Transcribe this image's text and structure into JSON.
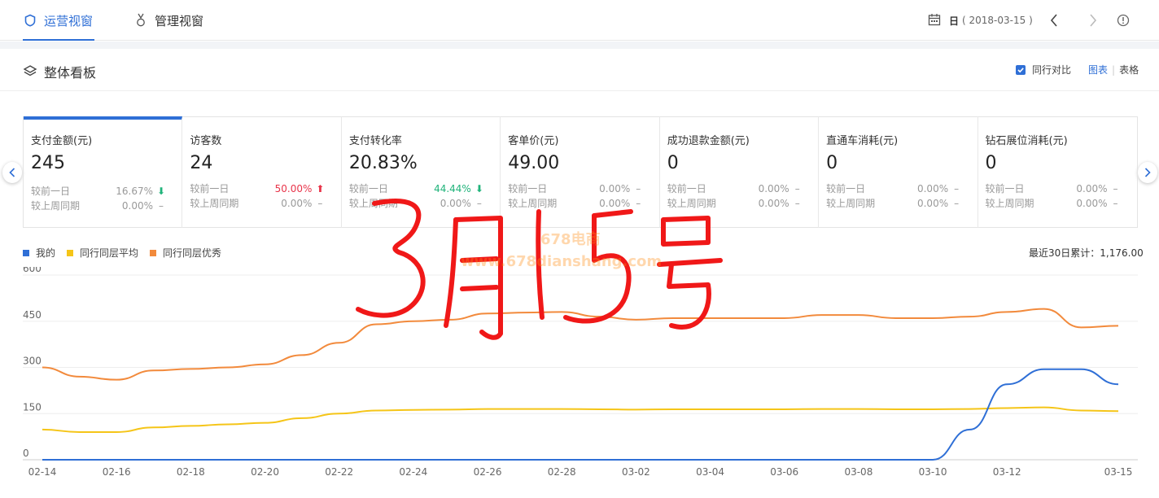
{
  "nav": {
    "tabs": [
      {
        "label": "运营视窗",
        "active": true,
        "icon": "shield-icon"
      },
      {
        "label": "管理视窗",
        "active": false,
        "icon": "medal-icon"
      }
    ],
    "date_mode": "日",
    "date_value": "( 2018-03-15 )"
  },
  "section": {
    "title": "整体看板",
    "compare_label": "同行对比",
    "compare_checked": true,
    "view_chart": "图表",
    "view_table": "表格"
  },
  "kpis": [
    {
      "name": "支付金额(元)",
      "value": "245",
      "day_label": "较前一日",
      "day_change": "16.67%",
      "day_dir": "down",
      "week_label": "较上周同期",
      "week_change": "0.00%",
      "week_dir": "flat"
    },
    {
      "name": "访客数",
      "value": "24",
      "day_label": "较前一日",
      "day_change": "50.00%",
      "day_dir": "up",
      "week_label": "较上周同期",
      "week_change": "0.00%",
      "week_dir": "flat"
    },
    {
      "name": "支付转化率",
      "value": "20.83%",
      "day_label": "较前一日",
      "day_change": "44.44%",
      "day_dir": "down",
      "week_label": "较上周同期",
      "week_change": "0.00%",
      "week_dir": "flat"
    },
    {
      "name": "客单价(元)",
      "value": "49.00",
      "day_label": "较前一日",
      "day_change": "0.00%",
      "day_dir": "flat",
      "week_label": "较上周同期",
      "week_change": "0.00%",
      "week_dir": "flat"
    },
    {
      "name": "成功退款金额(元)",
      "value": "0",
      "day_label": "较前一日",
      "day_change": "0.00%",
      "day_dir": "flat",
      "week_label": "较上周同期",
      "week_change": "0.00%",
      "week_dir": "flat"
    },
    {
      "name": "直通车消耗(元)",
      "value": "0",
      "day_label": "较前一日",
      "day_change": "0.00%",
      "day_dir": "flat",
      "week_label": "较上周同期",
      "week_change": "0.00%",
      "week_dir": "flat"
    },
    {
      "name": "钻石展位消耗(元)",
      "value": "0",
      "day_label": "较前一日",
      "day_change": "0.00%",
      "day_dir": "flat",
      "week_label": "较上周同期",
      "week_change": "0.00%",
      "week_dir": "flat"
    }
  ],
  "legend_total": "最近30日累计：1,176.00",
  "colors": {
    "accent": "#2f6fd6",
    "mine": "#2f6fd6",
    "avg": "#f5c518",
    "excellent": "#f28a3c",
    "up": "#e8344a",
    "down": "#1fb37a"
  },
  "watermark": {
    "line1": "678电商",
    "line2": "www.678dianshang.com"
  },
  "annotation": "3月15号",
  "chart_data": {
    "type": "line",
    "ylim": [
      0,
      600
    ],
    "yticks": [
      0,
      150,
      300,
      450,
      600
    ],
    "xtick_labels": [
      "02-14",
      "02-16",
      "02-18",
      "02-20",
      "02-22",
      "02-24",
      "02-26",
      "02-28",
      "03-02",
      "03-04",
      "03-06",
      "03-08",
      "03-10",
      "03-12",
      "03-15"
    ],
    "x": [
      "02-14",
      "02-15",
      "02-16",
      "02-17",
      "02-18",
      "02-19",
      "02-20",
      "02-21",
      "02-22",
      "02-23",
      "02-24",
      "02-25",
      "02-26",
      "02-27",
      "02-28",
      "03-01",
      "03-02",
      "03-03",
      "03-04",
      "03-05",
      "03-06",
      "03-07",
      "03-08",
      "03-09",
      "03-10",
      "03-11",
      "03-12",
      "03-13",
      "03-14",
      "03-15"
    ],
    "series": [
      {
        "name": "我的",
        "color": "#2f6fd6",
        "values": [
          0,
          0,
          0,
          0,
          0,
          0,
          0,
          0,
          0,
          0,
          0,
          0,
          0,
          0,
          0,
          0,
          0,
          0,
          0,
          0,
          0,
          0,
          0,
          0,
          0,
          98,
          245,
          294,
          294,
          245
        ]
      },
      {
        "name": "同行同层平均",
        "color": "#f5c518",
        "values": [
          98,
          90,
          90,
          105,
          110,
          115,
          120,
          135,
          150,
          160,
          162,
          163,
          165,
          165,
          165,
          164,
          163,
          164,
          164,
          164,
          164,
          165,
          165,
          164,
          164,
          165,
          168,
          170,
          160,
          158
        ]
      },
      {
        "name": "同行同层优秀",
        "color": "#f28a3c",
        "values": [
          300,
          270,
          260,
          290,
          295,
          300,
          310,
          340,
          380,
          440,
          450,
          455,
          475,
          478,
          480,
          465,
          455,
          460,
          460,
          460,
          460,
          470,
          470,
          460,
          460,
          465,
          480,
          490,
          430,
          435
        ]
      }
    ]
  }
}
